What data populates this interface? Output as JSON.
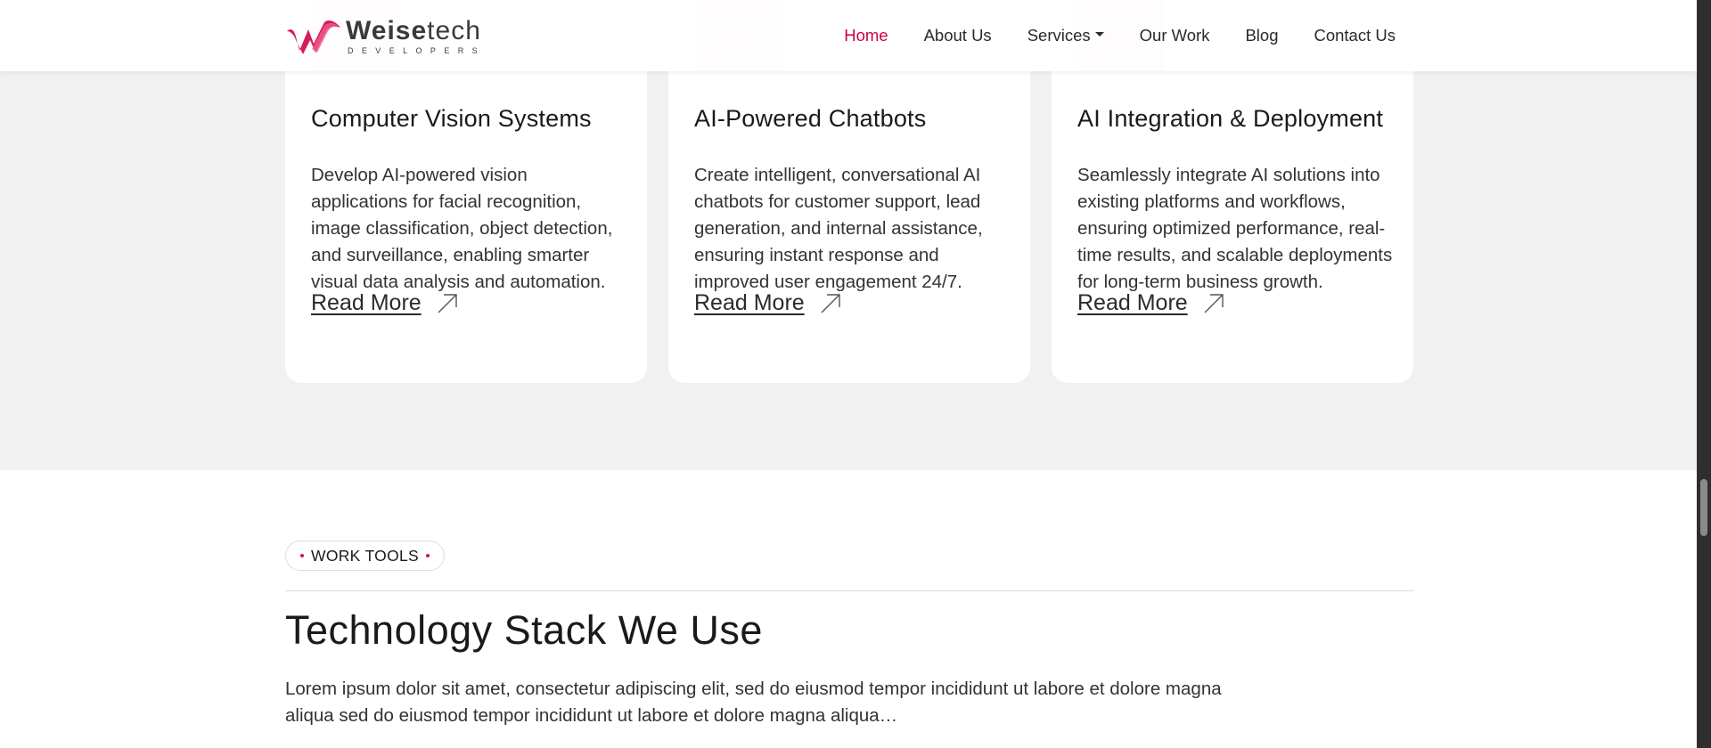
{
  "navbar": {
    "logo": {
      "name_bold": "Weise",
      "name_light": "tech",
      "tagline": "DEVELOPERS"
    },
    "links": [
      {
        "label": "Home",
        "active": true
      },
      {
        "label": "About Us"
      },
      {
        "label": "Services",
        "dropdown": true
      },
      {
        "label": "Our Work"
      },
      {
        "label": "Blog"
      },
      {
        "label": "Contact Us"
      }
    ]
  },
  "services": {
    "cards": [
      {
        "title": "Computer Vision Systems",
        "description": "Develop AI-powered vision applications for facial recognition, image classification, object detection, and surveillance, enabling smarter visual data analysis and automation.",
        "link_label": "Read More"
      },
      {
        "title": "AI-Powered Chatbots",
        "description": "Create intelligent, conversational AI chatbots for customer support, lead generation, and internal assistance, ensuring instant response and improved user engagement 24/7.",
        "link_label": "Read More"
      },
      {
        "title": "AI Integration & Deployment",
        "description": "Seamlessly integrate AI solutions into existing platforms and workflows, ensuring optimized performance, real-time results, and scalable deployments for long-term business growth.",
        "link_label": "Read More"
      }
    ]
  },
  "tools_section": {
    "pill_label": "WORK TOOLS",
    "title": "Technology Stack We Use",
    "description": "Lorem ipsum dolor sit amet, consectetur adipiscing elit, sed do eiusmod tempor incididunt ut labore et dolore magna aliqua sed do eiusmod tempor incididunt ut labore et dolore magna aliqua…"
  },
  "colors": {
    "accent": "#c8004b",
    "icon_pink": "#ee6f96",
    "section_bg": "#f1f1f1"
  },
  "icons": {
    "logo_mark": "weisetech-logo-mark",
    "read_more": "arrow-up-right-icon",
    "dropdown": "caret-down-icon"
  }
}
